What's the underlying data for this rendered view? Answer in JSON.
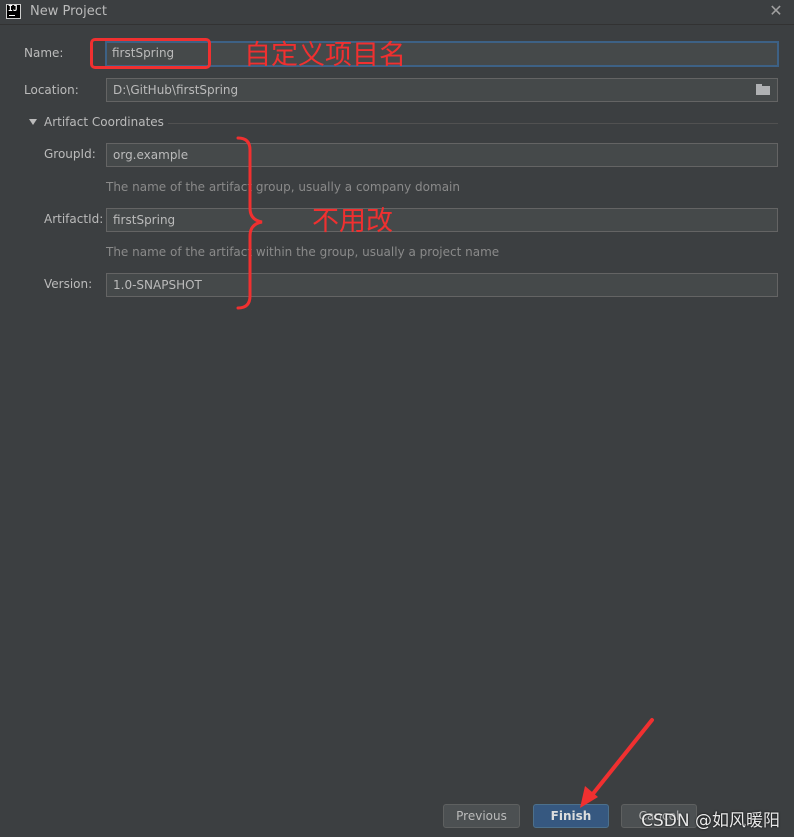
{
  "window": {
    "title": "New Project",
    "app_icon_text": "IJ"
  },
  "form": {
    "name": {
      "label": "Name:",
      "value": "firstSpring"
    },
    "location": {
      "label": "Location:",
      "value": "D:\\GitHub\\firstSpring"
    },
    "section": {
      "title": "Artifact Coordinates"
    },
    "group_id": {
      "label": "GroupId:",
      "value": "org.example",
      "hint": "The name of the artifact group, usually a company domain"
    },
    "artifact_id": {
      "label": "ArtifactId:",
      "value": "firstSpring",
      "hint": "The name of the artifact within the group, usually a project name"
    },
    "version": {
      "label": "Version:",
      "value": "1.0-SNAPSHOT"
    }
  },
  "buttons": {
    "previous": "Previous",
    "finish": "Finish",
    "cancel": "Cancel"
  },
  "annotations": {
    "name_note": "自定义项目名",
    "coords_note": "不用改",
    "color": "#f03030"
  },
  "watermark": "CSDN @如风暖阳",
  "colors": {
    "background": "#3c3f41",
    "field": "#45494a",
    "focus": "#3d6185",
    "primary_button": "#365880"
  },
  "icons": {
    "close": "close-icon",
    "folder": "folder-icon",
    "collapse": "triangle-down-icon"
  }
}
